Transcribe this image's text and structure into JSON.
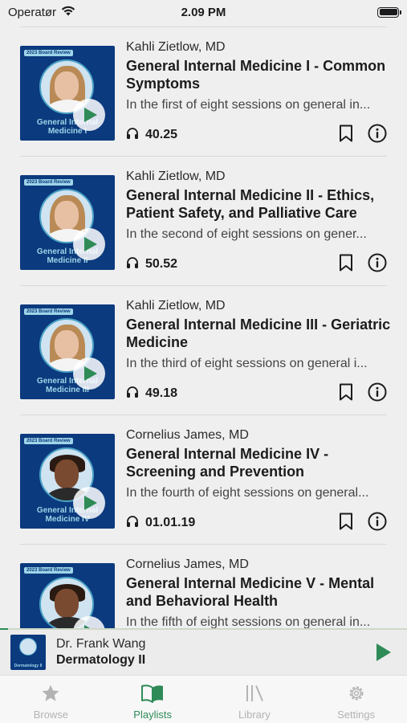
{
  "status_bar": {
    "carrier": "Operatør",
    "time": "2.09 PM"
  },
  "episodes": [
    {
      "author": "Kahli Zietlow, MD",
      "title": "General Internal Medicine I - Common Symptoms",
      "description": "In the first of eight sessions on general in...",
      "duration": "40.25",
      "thumb_tag": "2023 Board Review",
      "thumb_title": "General Internal Medicine I",
      "thumb_person": "woman"
    },
    {
      "author": "Kahli Zietlow, MD",
      "title": "General Internal Medicine II - Ethics, Patient Safety, and Palliative Care",
      "description": "In the second of eight sessions on gener...",
      "duration": "50.52",
      "thumb_tag": "2023 Board Review",
      "thumb_title": "General Internal Medicine II",
      "thumb_person": "woman"
    },
    {
      "author": "Kahli Zietlow, MD",
      "title": "General Internal Medicine III - Geriatric Medicine",
      "description": "In the third of eight sessions on general i...",
      "duration": "49.18",
      "thumb_tag": "2023 Board Review",
      "thumb_title": "General Internal Medicine III",
      "thumb_person": "woman"
    },
    {
      "author": "Cornelius James, MD",
      "title": "General Internal Medicine IV - Screening and Prevention",
      "description": "In the fourth of eight sessions on general...",
      "duration": "01.01.19",
      "thumb_tag": "2023 Board Review",
      "thumb_title": "General Internal Medicine IV",
      "thumb_person": "man"
    },
    {
      "author": "Cornelius James, MD",
      "title": "General Internal Medicine V - Mental and Behavioral Health",
      "description": "In the fifth of eight sessions on general in...",
      "duration": "",
      "thumb_tag": "2023 Board Review",
      "thumb_title": "",
      "thumb_person": "man"
    }
  ],
  "now_playing": {
    "author": "Dr. Frank Wang",
    "title": "Dermatology II",
    "thumb_title": "Dermatology II",
    "progress": 0.02
  },
  "tabs": [
    {
      "label": "Browse",
      "icon": "star-icon",
      "active": false
    },
    {
      "label": "Playlists",
      "icon": "book-icon",
      "active": true
    },
    {
      "label": "Library",
      "icon": "library-icon",
      "active": false
    },
    {
      "label": "Settings",
      "icon": "gear-icon",
      "active": false
    }
  ],
  "colors": {
    "accent": "#2e8b57",
    "thumb_bg": "#0b3a7e",
    "inactive_tab": "#b3b3b3"
  }
}
